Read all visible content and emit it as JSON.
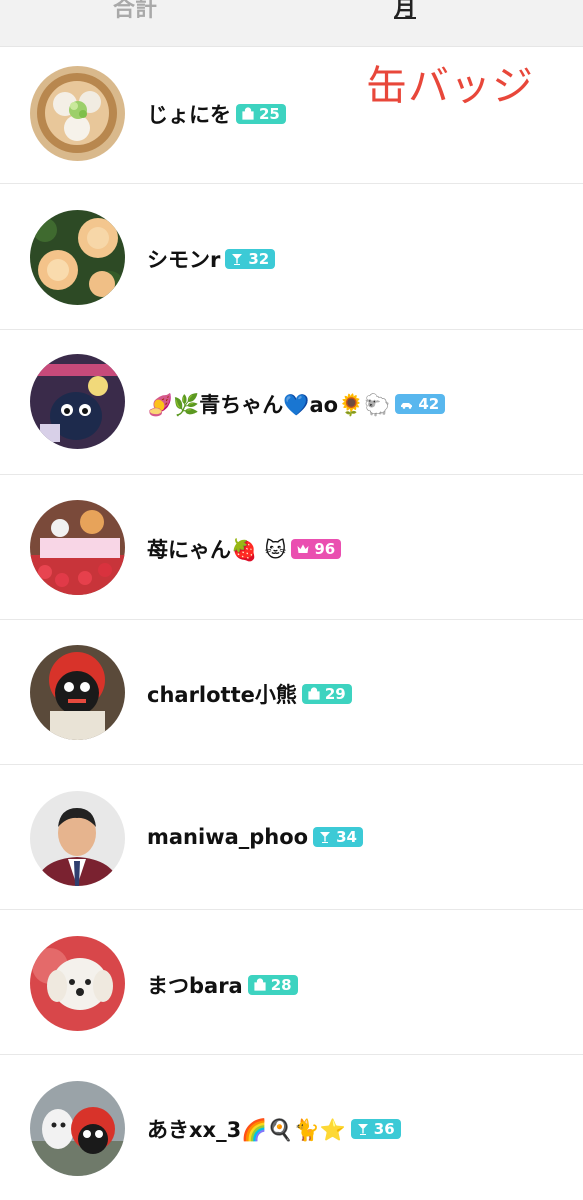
{
  "tabs": {
    "total": "合計",
    "month": "月"
  },
  "annotation": "缶バッジ",
  "rows": [
    {
      "name": "じょにを",
      "badge": "25",
      "badge_icon": "bag-icon",
      "badge_color": "#3dd3c0",
      "avatar": "ramen-avatar"
    },
    {
      "name": "シモンr",
      "badge": "32",
      "badge_icon": "cocktail-icon",
      "badge_color": "#3ccad6",
      "avatar": "roses-avatar"
    },
    {
      "name": "🍠🌿青ちゃん💙ao🌻🐑",
      "badge": "42",
      "badge_icon": "car-icon",
      "badge_color": "#58b7ee",
      "avatar": "mascot-night-avatar"
    },
    {
      "name": "苺にゃん🍓 🐱",
      "badge": "96",
      "badge_icon": "crown-icon",
      "badge_color": "#ea4fb0",
      "avatar": "cake-avatar"
    },
    {
      "name": "charlotte小熊",
      "badge": "29",
      "badge_icon": "bag-icon",
      "badge_color": "#3dd3c0",
      "avatar": "mascot-avatar"
    },
    {
      "name": "maniwa_phoo",
      "badge": "34",
      "badge_icon": "cocktail-icon",
      "badge_color": "#3ccad6",
      "avatar": "person-avatar"
    },
    {
      "name": "まつbara",
      "badge": "28",
      "badge_icon": "bag-icon",
      "badge_color": "#3dd3c0",
      "avatar": "dog-avatar"
    },
    {
      "name": "あきxx_3🌈🍳🐈⭐",
      "badge": "36",
      "badge_icon": "cocktail-icon",
      "badge_color": "#3ccad6",
      "avatar": "mascot-dog-avatar"
    }
  ]
}
